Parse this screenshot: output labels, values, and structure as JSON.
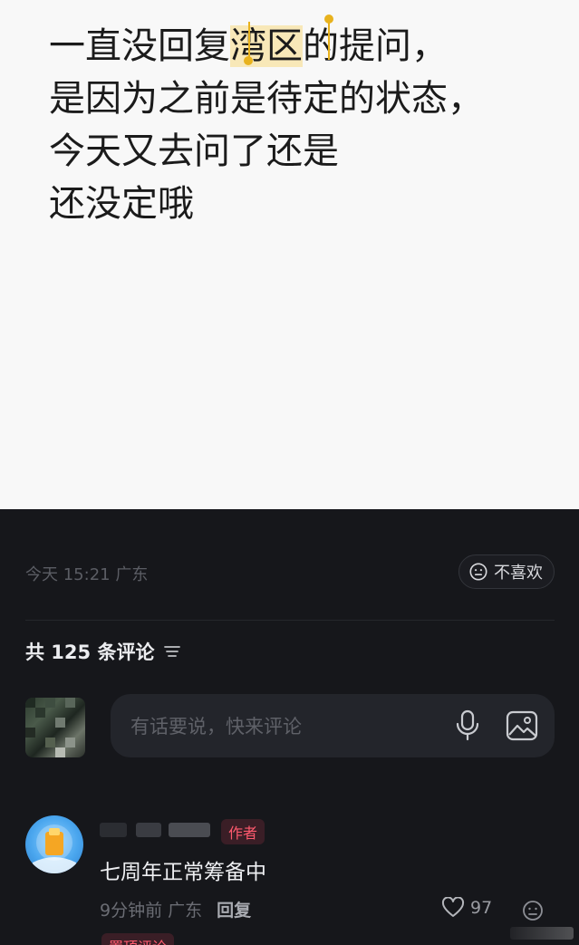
{
  "post": {
    "lines": [
      {
        "before": "一直没回复",
        "highlight": "湾区",
        "after": "的提问，"
      },
      {
        "text": "是因为之前是待定的状态，"
      },
      {
        "text": "今天又去问了还是"
      },
      {
        "text": "还没定哦"
      }
    ]
  },
  "meta": {
    "time_location": "今天 15:21 广东",
    "dislike_label": "不喜欢",
    "dislike_icon": "neutral-face-icon"
  },
  "comments_header": {
    "label": "共 125 条评论",
    "sort_icon": "sort-lines-icon"
  },
  "composer": {
    "placeholder": "有话要说，快来评论",
    "mic_icon": "microphone-icon",
    "image_icon": "image-icon"
  },
  "comment": {
    "badge": "作者",
    "text": "七周年正常筹备中",
    "time": "9分钟前",
    "location": "广东",
    "reply_label": "回复",
    "likes": "97",
    "pin_label": "置顶评论"
  },
  "colors": {
    "accent_red": "#ff5a6e",
    "selection": "#e8b21d",
    "dark_bg": "#16171b"
  }
}
